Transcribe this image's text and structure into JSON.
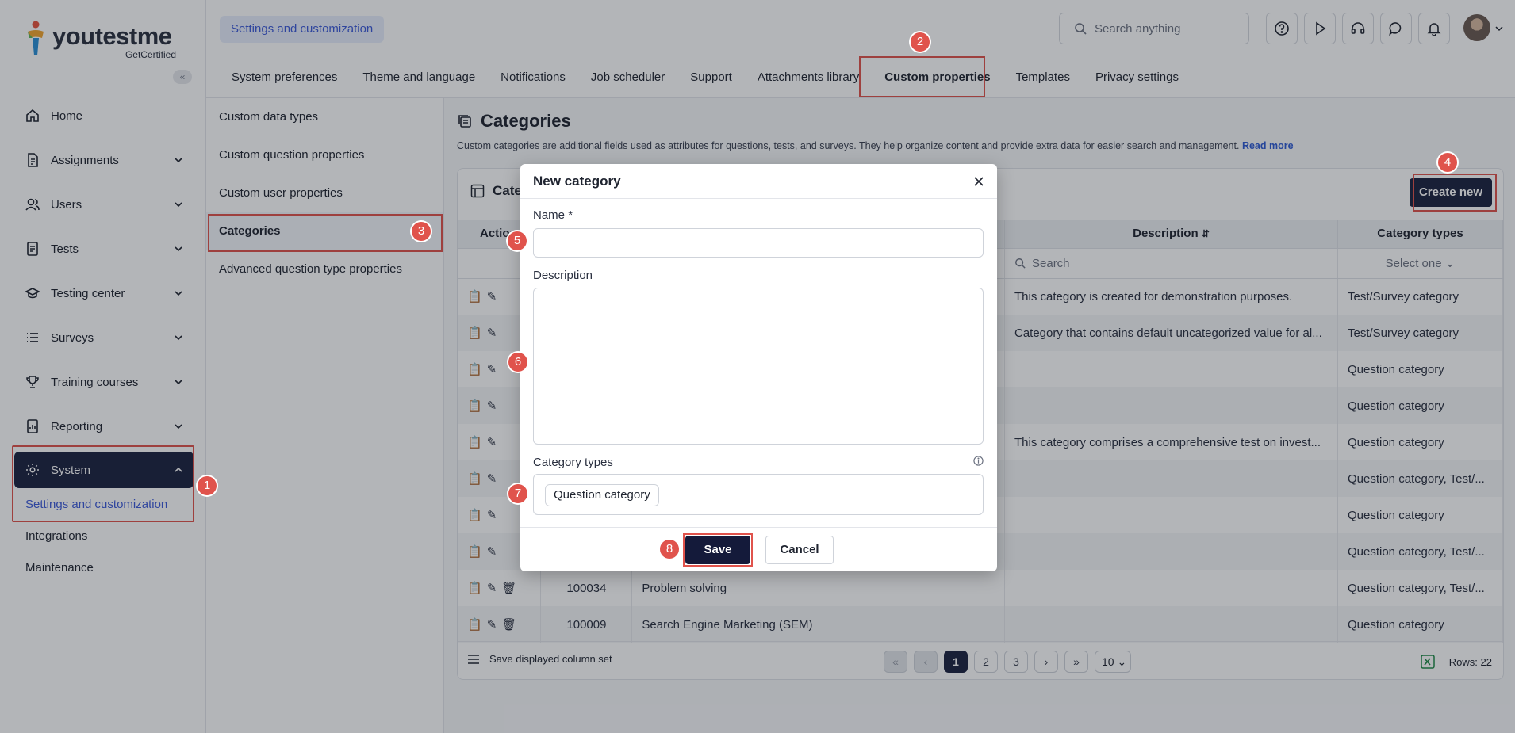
{
  "app": {
    "logo_text": "youtestme",
    "logo_sub": "GetCertified",
    "breadcrumb": "Settings and customization",
    "search_placeholder": "Search anything"
  },
  "sidebar": {
    "items": [
      {
        "label": "Home",
        "icon": "home-icon"
      },
      {
        "label": "Assignments",
        "icon": "assignments-icon"
      },
      {
        "label": "Users",
        "icon": "users-icon"
      },
      {
        "label": "Tests",
        "icon": "tests-icon"
      },
      {
        "label": "Testing center",
        "icon": "testing-center-icon"
      },
      {
        "label": "Surveys",
        "icon": "surveys-icon"
      },
      {
        "label": "Training courses",
        "icon": "trophy-icon"
      },
      {
        "label": "Reporting",
        "icon": "reporting-icon"
      },
      {
        "label": "System",
        "icon": "gear-icon"
      }
    ],
    "system_sub": [
      "Settings and customization",
      "Integrations",
      "Maintenance"
    ]
  },
  "tabs": [
    "System preferences",
    "Theme and language",
    "Notifications",
    "Job scheduler",
    "Support",
    "Attachments library",
    "Custom properties",
    "Templates",
    "Privacy settings"
  ],
  "submenu": [
    "Custom data types",
    "Custom question properties",
    "Custom user properties",
    "Categories",
    "Advanced question type properties"
  ],
  "page": {
    "title": "Categories",
    "description": "Custom categories are additional fields used as attributes for questions, tests, and surveys. They help organize content and provide extra data for easier search and management.",
    "read_more": "Read more",
    "card_title": "Cate",
    "create_new": "Create new"
  },
  "table": {
    "headers": {
      "actions": "Actions",
      "description": "Description",
      "types": "Category types"
    },
    "filter_search": "Search",
    "filter_select": "Select one",
    "rows": [
      {
        "id": "",
        "name": "",
        "description": "This category is created for demonstration purposes.",
        "types": "Test/Survey category"
      },
      {
        "id": "",
        "name": "",
        "description": "Category that contains default uncategorized value for al...",
        "types": "Test/Survey category"
      },
      {
        "id": "",
        "name": "",
        "description": "",
        "types": "Question category"
      },
      {
        "id": "",
        "name": "",
        "description": "",
        "types": "Question category"
      },
      {
        "id": "",
        "name": "",
        "description": "This category comprises a comprehensive test on invest...",
        "types": "Question category"
      },
      {
        "id": "",
        "name": "",
        "description": "",
        "types": "Question category, Test/..."
      },
      {
        "id": "",
        "name": "",
        "description": "",
        "types": "Question category"
      },
      {
        "id": "",
        "name": "",
        "description": "",
        "types": "Question category, Test/..."
      },
      {
        "id": "100034",
        "name": "Problem solving",
        "description": "",
        "types": "Question category, Test/..."
      },
      {
        "id": "100009",
        "name": "Search Engine Marketing (SEM)",
        "description": "",
        "types": "Question category"
      }
    ]
  },
  "pager": {
    "save_set": "Save displayed column set",
    "first": "«",
    "prev": "‹",
    "pages": [
      "1",
      "2",
      "3"
    ],
    "next": "›",
    "last": "»",
    "size": "10",
    "rows": "Rows: 22"
  },
  "modal": {
    "title": "New category",
    "name_label": "Name",
    "required_mark": "*",
    "description_label": "Description",
    "types_label": "Category types",
    "type_chip": "Question category",
    "save": "Save",
    "cancel": "Cancel"
  },
  "steps": [
    "1",
    "2",
    "3",
    "4",
    "5",
    "6",
    "7",
    "8"
  ],
  "colors": {
    "accent": "#1b2240",
    "highlight": "#e0534c",
    "link": "#3d5bd9"
  }
}
